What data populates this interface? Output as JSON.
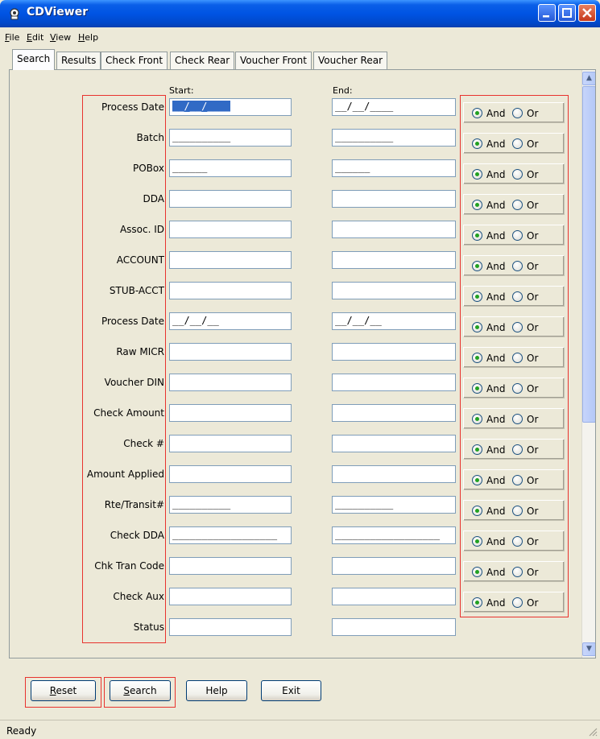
{
  "window": {
    "title": "CDViewer"
  },
  "menu": [
    {
      "label": "File",
      "accel": "F",
      "rest": "ile"
    },
    {
      "label": "Edit",
      "accel": "E",
      "rest": "dit"
    },
    {
      "label": "View",
      "accel": "V",
      "rest": "iew"
    },
    {
      "label": "Help",
      "accel": "H",
      "rest": "elp"
    }
  ],
  "tabs": [
    "Search",
    "Results",
    "Check Front",
    "Check Rear",
    "Voucher Front",
    "Voucher Rear"
  ],
  "active_tab": "Search",
  "columns": {
    "start": "Start:",
    "end": "End:"
  },
  "rows": [
    {
      "label": "Process Date",
      "start": "__/__/____",
      "end": "__/__/____",
      "start_selected": true,
      "and": true
    },
    {
      "label": "Batch",
      "start": "__________",
      "end": "__________",
      "and": true
    },
    {
      "label": "POBox",
      "start": "______",
      "end": "______",
      "and": true
    },
    {
      "label": "DDA",
      "start": "",
      "end": "",
      "and": true
    },
    {
      "label": "Assoc. ID",
      "start": "",
      "end": "",
      "and": true
    },
    {
      "label": "ACCOUNT",
      "start": "",
      "end": "",
      "and": true
    },
    {
      "label": "STUB-ACCT",
      "start": "",
      "end": "",
      "and": true
    },
    {
      "label": "Process Date",
      "start": "__/__/__",
      "end": "__/__/__",
      "and": true
    },
    {
      "label": "Raw MICR",
      "start": "",
      "end": "",
      "and": true
    },
    {
      "label": "Voucher DIN",
      "start": "",
      "end": "",
      "and": true
    },
    {
      "label": "Check Amount",
      "start": "",
      "end": "",
      "and": true
    },
    {
      "label": "Check #",
      "start": "",
      "end": "",
      "and": true
    },
    {
      "label": "Amount Applied",
      "start": "",
      "end": "",
      "and": true
    },
    {
      "label": "Rte/Transit#",
      "start": "__________",
      "end": "__________",
      "and": true
    },
    {
      "label": "Check DDA",
      "start": "__________________",
      "end": "__________________",
      "and": true
    },
    {
      "label": "Chk Tran Code",
      "start": "",
      "end": "",
      "and": true
    },
    {
      "label": "Check Aux",
      "start": "",
      "end": "",
      "and": true
    },
    {
      "label": "Status",
      "start": "",
      "end": ""
    }
  ],
  "andor_labels": {
    "and": "And",
    "or": "Or"
  },
  "buttons": {
    "reset": {
      "accel": "R",
      "rest": "eset"
    },
    "search": {
      "accel": "S",
      "rest": "earch"
    },
    "help": "Help",
    "exit": "Exit"
  },
  "status": "Ready",
  "colors": {
    "titlebar": "#0054e3",
    "highlight_box": "#e8332e",
    "selection": "#316ac5"
  }
}
